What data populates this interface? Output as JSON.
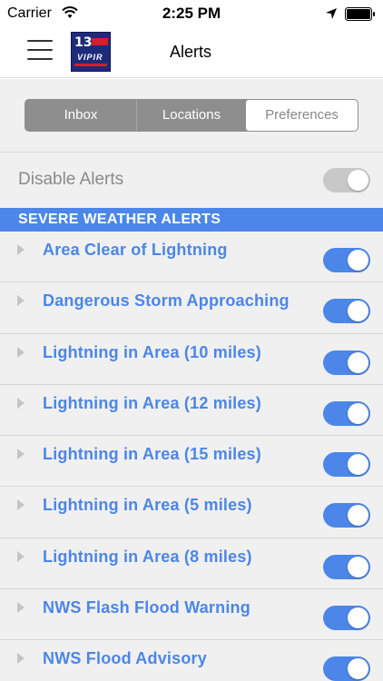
{
  "status_bar": {
    "carrier": "Carrier",
    "time": "2:25 PM"
  },
  "nav": {
    "title": "Alerts",
    "logo_number": "13",
    "logo_text": "VIPIR"
  },
  "tabs": [
    {
      "label": "Inbox",
      "selected": false
    },
    {
      "label": "Locations",
      "selected": false
    },
    {
      "label": "Preferences",
      "selected": true
    }
  ],
  "disable_alerts": {
    "label": "Disable Alerts",
    "enabled": false
  },
  "section": {
    "title": "SEVERE WEATHER ALERTS",
    "items": [
      {
        "label": "Area Clear of Lightning",
        "enabled": true
      },
      {
        "label": "Dangerous Storm Approaching",
        "enabled": true
      },
      {
        "label": "Lightning in Area (10 miles)",
        "enabled": true
      },
      {
        "label": "Lightning in Area (12 miles)",
        "enabled": true
      },
      {
        "label": "Lightning in Area (15 miles)",
        "enabled": true
      },
      {
        "label": "Lightning in Area (5 miles)",
        "enabled": true
      },
      {
        "label": "Lightning in Area (8 miles)",
        "enabled": true
      },
      {
        "label": "NWS Flash Flood Warning",
        "enabled": true
      },
      {
        "label": "NWS Flood Advisory",
        "enabled": true
      }
    ]
  },
  "colors": {
    "accent": "#4b86e8",
    "toggle_off": "#c8c8c8",
    "background": "#f0f0f0"
  }
}
